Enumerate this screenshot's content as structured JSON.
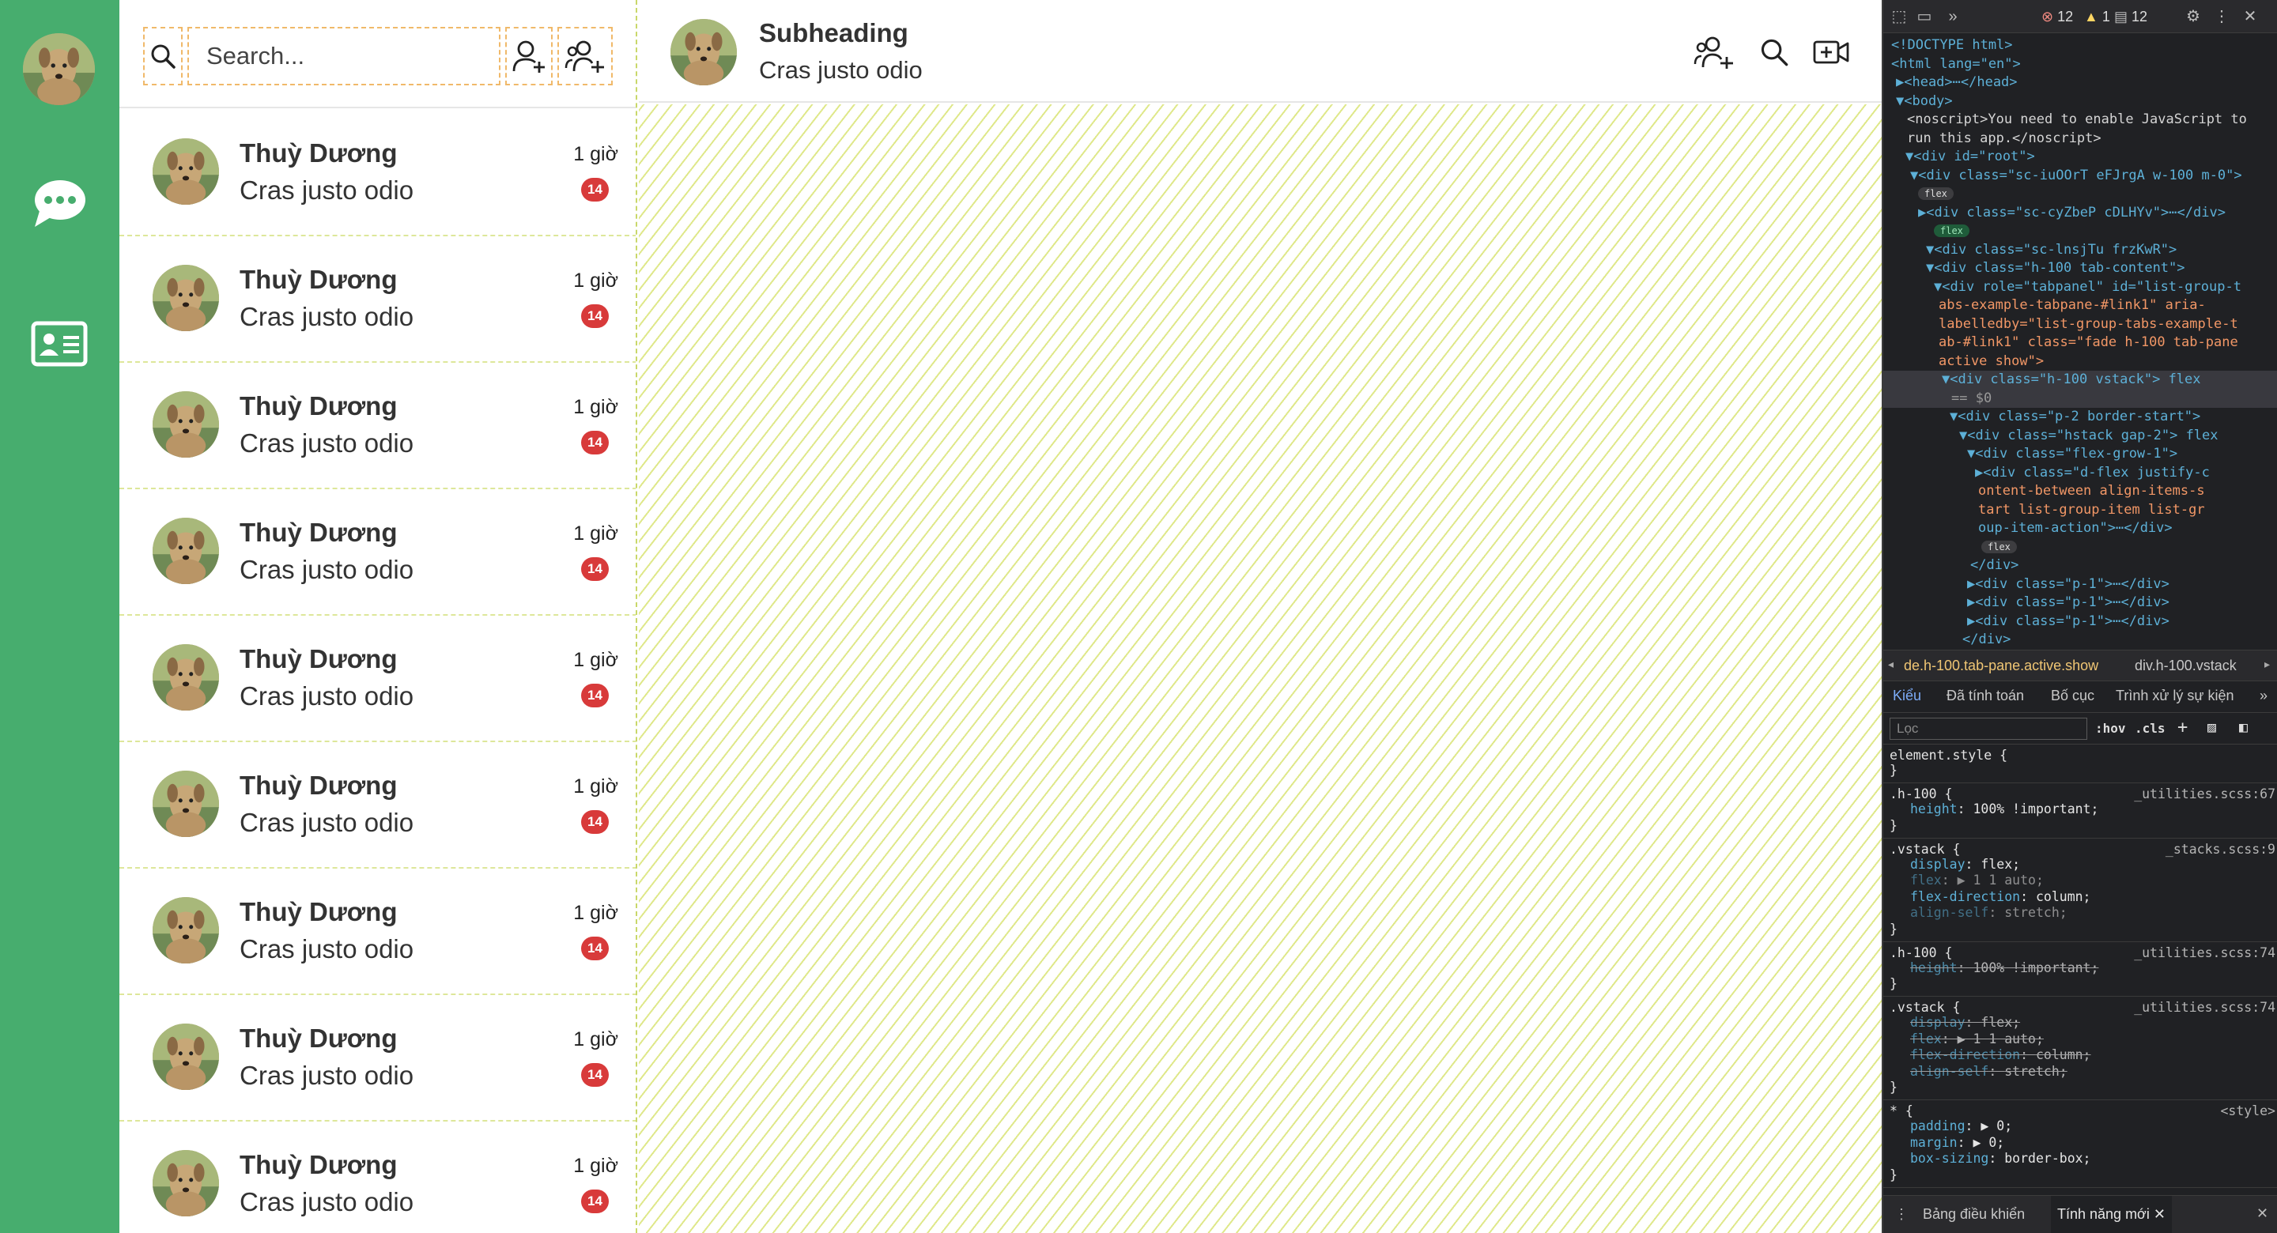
{
  "sidebar": {
    "items": [
      {
        "icon": "chat-bubble-icon"
      },
      {
        "icon": "contact-card-icon"
      }
    ]
  },
  "search": {
    "placeholder": "Search..."
  },
  "contacts": [
    {
      "name": "Thuỳ Dương",
      "preview": "Cras justo odio",
      "time": "1 giờ",
      "badge": "14"
    },
    {
      "name": "Thuỳ Dương",
      "preview": "Cras justo odio",
      "time": "1 giờ",
      "badge": "14"
    },
    {
      "name": "Thuỳ Dương",
      "preview": "Cras justo odio",
      "time": "1 giờ",
      "badge": "14"
    },
    {
      "name": "Thuỳ Dương",
      "preview": "Cras justo odio",
      "time": "1 giờ",
      "badge": "14"
    },
    {
      "name": "Thuỳ Dương",
      "preview": "Cras justo odio",
      "time": "1 giờ",
      "badge": "14"
    },
    {
      "name": "Thuỳ Dương",
      "preview": "Cras justo odio",
      "time": "1 giờ",
      "badge": "14"
    },
    {
      "name": "Thuỳ Dương",
      "preview": "Cras justo odio",
      "time": "1 giờ",
      "badge": "14"
    },
    {
      "name": "Thuỳ Dương",
      "preview": "Cras justo odio",
      "time": "1 giờ",
      "badge": "14"
    },
    {
      "name": "Thuỳ Dương",
      "preview": "Cras justo odio",
      "time": "1 giờ",
      "badge": "14"
    }
  ],
  "chat": {
    "title": "Subheading",
    "subtitle": "Cras justo odio"
  },
  "colors": {
    "sidebar": "#47ad6e",
    "badge": "#d83a3a",
    "devtools_bg": "#202124"
  },
  "devtools": {
    "errors": "12",
    "warnings": "1",
    "messages": "12",
    "dom_lines": [
      {
        "t": "<!DOCTYPE html>"
      },
      {
        "t": "<html lang=\"en\">"
      },
      {
        "t": "▶<head>⋯</head>"
      },
      {
        "t": "▼<body>"
      },
      {
        "t": "<noscript>You need to enable JavaScript to"
      },
      {
        "t": "run this app.</noscript>"
      },
      {
        "t": "▼<div id=\"root\">"
      },
      {
        "t": "▼<div class=\"sc-iuOOrT eFJrgA w-100 m-0\">"
      },
      {
        "t": "flex"
      },
      {
        "t": "▶<div class=\"sc-cyZbeP cDLHYv\">⋯</div>"
      },
      {
        "t": "flex"
      },
      {
        "t": "▼<div class=\"sc-lnsjTu frzKwR\">"
      },
      {
        "t": "▼<div class=\"h-100 tab-content\">"
      },
      {
        "t": "▼<div role=\"tabpanel\" id=\"list-group-t"
      },
      {
        "t": "abs-example-tabpane-#link1\" aria-"
      },
      {
        "t": "labelledby=\"list-group-tabs-example-t"
      },
      {
        "t": "ab-#link1\" class=\"fade h-100 tab-pane"
      },
      {
        "t": "active show\">"
      },
      {
        "t": "▼<div class=\"h-100 vstack\"> flex"
      },
      {
        "t": "== $0"
      },
      {
        "t": "▼<div class=\"p-2 border-start\">"
      },
      {
        "t": "▼<div class=\"hstack gap-2\"> flex"
      },
      {
        "t": "▼<div class=\"flex-grow-1\">"
      },
      {
        "t": "▶<div class=\"d-flex justify-c"
      },
      {
        "t": "ontent-between align-items-s"
      },
      {
        "t": "tart list-group-item list-gr"
      },
      {
        "t": "oup-item-action\">⋯</div>"
      },
      {
        "t": "flex"
      },
      {
        "t": "</div>"
      },
      {
        "t": "▶<div class=\"p-1\">⋯</div>"
      },
      {
        "t": "▶<div class=\"p-1\">⋯</div>"
      },
      {
        "t": "▶<div class=\"p-1\">⋯</div>"
      },
      {
        "t": "</div>"
      }
    ],
    "crumbs": [
      "de.h-100.tab-pane.active.show",
      "div.h-100.vstack"
    ],
    "tabs": [
      "Kiểu",
      "Đã tính toán",
      "Bố cục",
      "Trình xử lý sự kiện"
    ],
    "filter_placeholder": "Lọc",
    "filter_tools": [
      ":hov",
      ".cls"
    ],
    "rules": [
      {
        "selector": "element.style {",
        "source": "",
        "decls": []
      },
      {
        "selector": ".h-100 {",
        "source": "_utilities.scss:67",
        "decls": [
          {
            "p": "height",
            "v": "100% !important;"
          }
        ]
      },
      {
        "selector": ".vstack {",
        "source": "_stacks.scss:9",
        "decls": [
          {
            "p": "display",
            "v": "flex;"
          },
          {
            "p": "flex",
            "v": "▶ 1 1 auto;"
          },
          {
            "p": "flex-direction",
            "v": "column;"
          },
          {
            "p": "align-self",
            "v": "stretch;"
          }
        ]
      },
      {
        "selector": ".h-100 {",
        "source": "_utilities.scss:74",
        "decls": [
          {
            "p": "height",
            "v": "100% !important;"
          }
        ]
      },
      {
        "selector": ".vstack {",
        "source": "_utilities.scss:74",
        "decls": [
          {
            "p": "display",
            "v": "flex;"
          },
          {
            "p": "flex",
            "v": "▶ 1 1 auto;"
          },
          {
            "p": "flex-direction",
            "v": "column;"
          },
          {
            "p": "align-self",
            "v": "stretch;"
          }
        ]
      },
      {
        "selector": "* {",
        "source": "<style>",
        "decls": [
          {
            "p": "padding",
            "v": "▶ 0;"
          },
          {
            "p": "margin",
            "v": "▶ 0;"
          },
          {
            "p": "box-sizing",
            "v": "border-box;"
          }
        ]
      }
    ],
    "drawer": {
      "console": "Bảng điều khiển",
      "whats_new": "Tính năng mới"
    }
  }
}
